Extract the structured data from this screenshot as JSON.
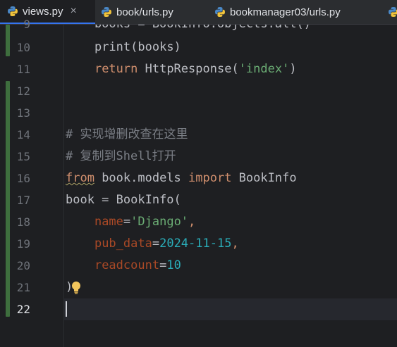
{
  "tabs": [
    {
      "label": "views.py",
      "active": true,
      "close": "×"
    },
    {
      "label": "book/urls.py",
      "active": false
    },
    {
      "label": "bookmanager03/urls.py",
      "active": false
    }
  ],
  "line_numbers": [
    "9",
    "10",
    "11",
    "12",
    "13",
    "14",
    "15",
    "16",
    "17",
    "18",
    "19",
    "20",
    "21",
    "22"
  ],
  "current_line": "22",
  "code": {
    "l9": "    books = BookInfo.objects.all()",
    "l10_fn": "print",
    "l10_rest": "(books)",
    "l11_kw": "return",
    "l11_mid": " HttpResponse(",
    "l11_str": "'index'",
    "l11_end": ")",
    "l14": "# 实现增删改查在这里",
    "l15": "# 复制到Shell打开",
    "l16_from": "from",
    "l16_mod": " book.models ",
    "l16_import": "import",
    "l16_name": " BookInfo",
    "l17": "book = BookInfo(",
    "l18_param": "name",
    "l18_eq": "=",
    "l18_str": "'Django'",
    "l18_comma": ",",
    "l19_param": "pub_data",
    "l19_eq": "=",
    "l19_num": "2024-11-15",
    "l19_comma": ",",
    "l20_param": "readcount",
    "l20_eq": "=",
    "l20_num": "10",
    "l21": ")"
  },
  "colors": {
    "background": "#1e1f22",
    "keyword": "#cf8e6d",
    "string": "#6aab73",
    "number": "#2aacb8",
    "parameter": "#aa4926",
    "comment": "#7a7e85",
    "change_marker": "#3e6e3e",
    "accent": "#3574f0"
  },
  "icons": [
    "python-file-icon",
    "lightbulb-icon",
    "close-icon"
  ]
}
